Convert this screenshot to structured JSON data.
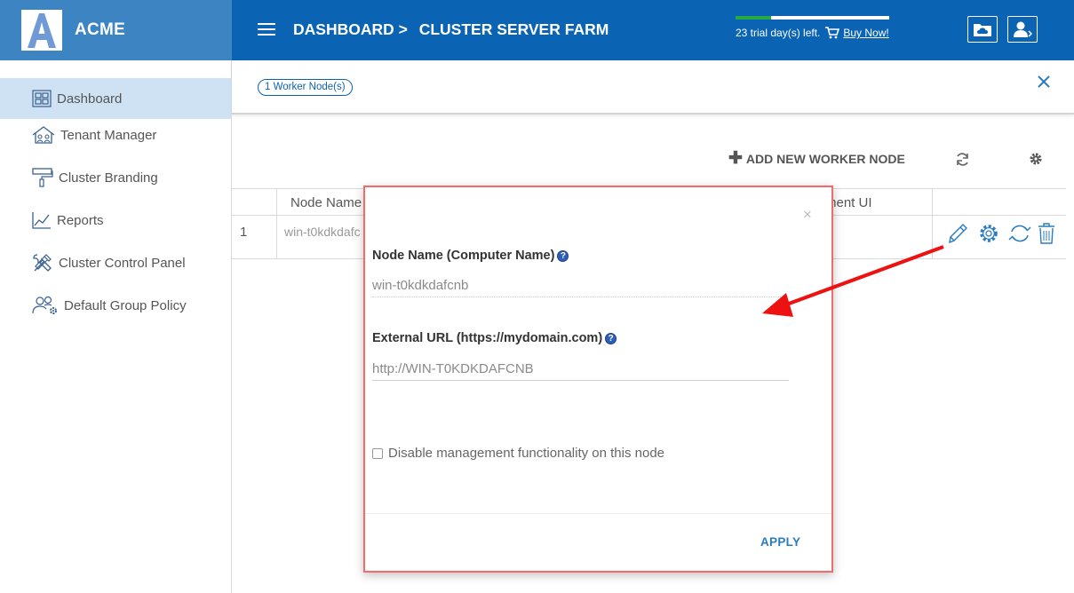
{
  "brand": {
    "name": "ACME",
    "logo_letter": "A"
  },
  "header": {
    "breadcrumb_root": "DASHBOARD >",
    "breadcrumb_current": "CLUSTER SERVER FARM",
    "trial_text": "23 trial day(s) left.",
    "trial_progress": 0.23,
    "buy_now": "Buy Now!",
    "accent_color": "#0b63b3",
    "progress_color": "#27a844"
  },
  "sidebar": {
    "items": [
      {
        "label": "Dashboard",
        "icon": "dashboard-icon",
        "active": true
      },
      {
        "label": "Tenant Manager",
        "icon": "tenant-house-icon",
        "active": false
      },
      {
        "label": "Cluster Branding",
        "icon": "paint-roller-icon",
        "active": false
      },
      {
        "label": "Reports",
        "icon": "chart-icon",
        "active": false
      },
      {
        "label": "Cluster Control Panel",
        "icon": "tools-icon",
        "active": false
      },
      {
        "label": "Default Group Policy",
        "icon": "users-gear-icon",
        "active": false
      }
    ]
  },
  "main": {
    "worker_badge": "1 Worker Node(s)",
    "add_worker_label": "ADD NEW WORKER NODE",
    "table": {
      "headers": [
        "Node Name",
        "ment UI"
      ],
      "rows": [
        {
          "index": "1",
          "node_name": "win-t0kdkdafc"
        }
      ]
    }
  },
  "modal": {
    "node_name_label": "Node Name (Computer Name)",
    "node_name_value": "win-t0kdkdafcnb",
    "external_url_label": "External URL (https://mydomain.com)",
    "external_url_value": "http://WIN-T0KDKDAFCNB",
    "checkbox_label": "Disable management functionality on this node",
    "checkbox_checked": false,
    "close_glyph": "×",
    "apply_label": "APPLY",
    "help_glyph": "?"
  }
}
